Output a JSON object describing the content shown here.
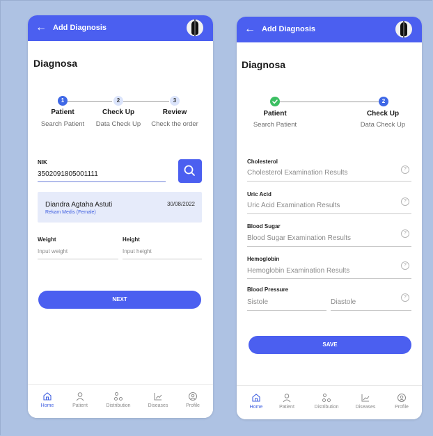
{
  "header": {
    "title": "Add Diagnosis"
  },
  "page_title": "Diagnosa",
  "screen1": {
    "steps": [
      {
        "num": "1",
        "label": "Patient",
        "sub": "Search Patient"
      },
      {
        "num": "2",
        "label": "Check Up",
        "sub": "Data Check Up"
      },
      {
        "num": "3",
        "label": "Review",
        "sub": "Check the order"
      }
    ],
    "nik_label": "NIK",
    "nik_value": "3502091805001111",
    "patient": {
      "name": "Diandra Agtaha Astuti",
      "sub": "Rekam Medis (Female)",
      "date": "30/08/2022"
    },
    "weight_label": "Weight",
    "weight_placeholder": "Input weight",
    "height_label": "Height",
    "height_placeholder": "Input height",
    "next_label": "NEXT"
  },
  "screen2": {
    "steps": [
      {
        "num": "",
        "label": "Patient",
        "sub": "Search Patient"
      },
      {
        "num": "2",
        "label": "Check Up",
        "sub": "Data Check Up"
      }
    ],
    "fields": [
      {
        "label": "Cholesterol",
        "placeholder": "Cholesterol Examination Results"
      },
      {
        "label": "Uric Acid",
        "placeholder": "Uric Acid Examination Results"
      },
      {
        "label": "Blood Sugar",
        "placeholder": "Blood Sugar Examination Results"
      },
      {
        "label": "Hemoglobin",
        "placeholder": "Hemoglobin Examination Results"
      }
    ],
    "bp_label": "Blood Pressure",
    "bp_sistole": "Sistole",
    "bp_diastole": "Diastole",
    "help_glyph": "?",
    "save_label": "SAVE"
  },
  "nav": {
    "items": [
      {
        "label": "Home",
        "icon": "home-icon"
      },
      {
        "label": "Patient",
        "icon": "person-icon"
      },
      {
        "label": "Distribution",
        "icon": "distribution-icon"
      },
      {
        "label": "Diseases",
        "icon": "chart-icon"
      },
      {
        "label": "Profile",
        "icon": "profile-icon"
      }
    ]
  },
  "colors": {
    "primary": "#4b5ff0",
    "success": "#3bbf62",
    "background": "#aec2e3"
  }
}
